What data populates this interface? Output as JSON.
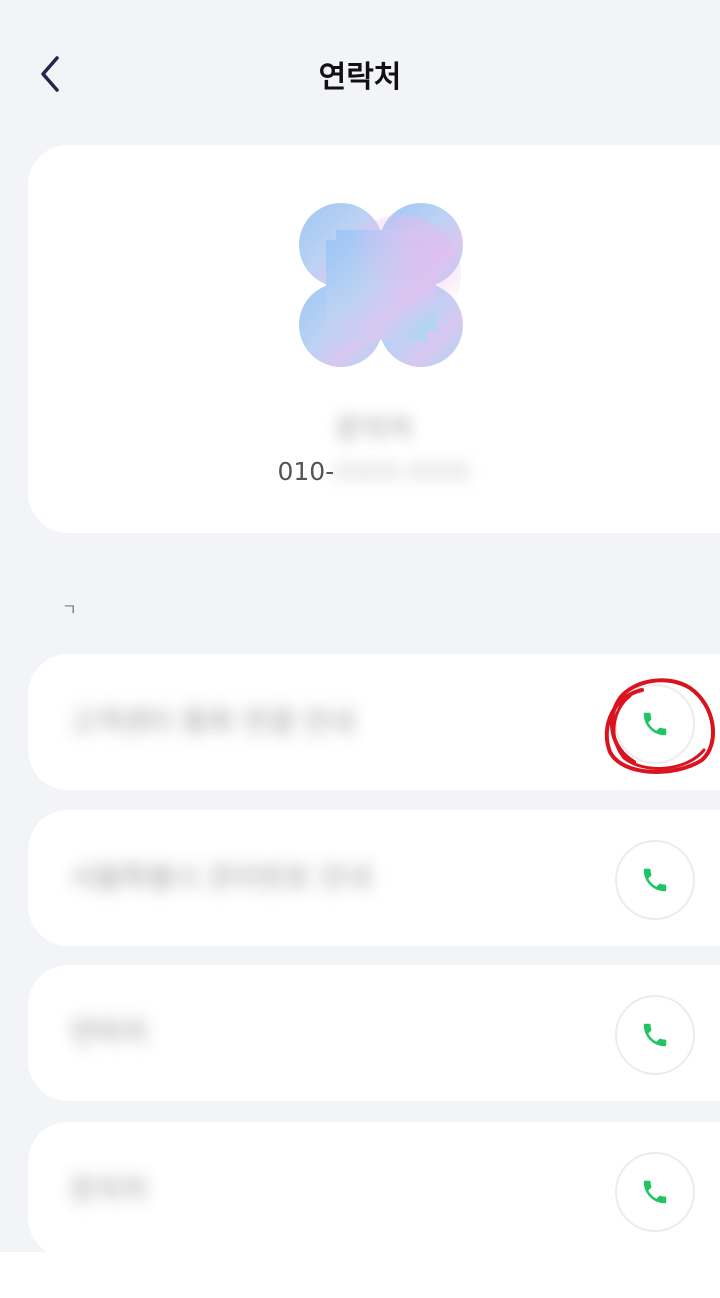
{
  "header": {
    "title": "연락처",
    "back_icon": "chevron-left-icon"
  },
  "profile": {
    "avatar_icon": "clover-gradient-avatar",
    "name": "문의처",
    "phone_prefix": "010-",
    "phone_rest": "0000-0000"
  },
  "section": {
    "label": "ㄱ"
  },
  "contacts": [
    {
      "label": "고객센터 통화 연결 안내",
      "call_icon": "phone-icon"
    },
    {
      "label": "서울특별시 관리번호 안내",
      "call_icon": "phone-icon"
    },
    {
      "label": "연락처",
      "call_icon": "phone-icon"
    },
    {
      "label": "문의처",
      "call_icon": "phone-icon"
    }
  ],
  "colors": {
    "accent_green": "#1fc463",
    "annotation_red": "#d9141f",
    "background": "#f3f4f7"
  }
}
